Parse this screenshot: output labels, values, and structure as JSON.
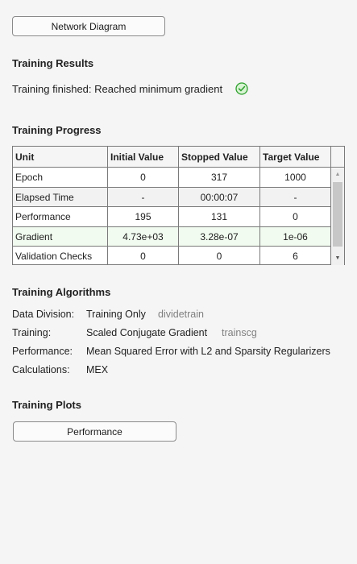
{
  "buttons": {
    "network_diagram": "Network Diagram",
    "performance": "Performance"
  },
  "results": {
    "title": "Training Results",
    "status": "Training finished: Reached minimum gradient",
    "status_icon": "check-circle-icon",
    "status_color": "#2ea02e"
  },
  "progress": {
    "title": "Training Progress",
    "columns": [
      "Unit",
      "Initial Value",
      "Stopped Value",
      "Target Value"
    ],
    "rows": [
      {
        "unit": "Epoch",
        "initial": "0",
        "stopped": "317",
        "target": "1000"
      },
      {
        "unit": "Elapsed Time",
        "initial": "-",
        "stopped": "00:00:07",
        "target": "-"
      },
      {
        "unit": "Performance",
        "initial": "195",
        "stopped": "131",
        "target": "0"
      },
      {
        "unit": "Gradient",
        "initial": "4.73e+03",
        "stopped": "3.28e-07",
        "target": "1e-06"
      },
      {
        "unit": "Validation Checks",
        "initial": "0",
        "stopped": "0",
        "target": "6"
      }
    ],
    "highlight_color": "#f1fbef"
  },
  "algorithms": {
    "title": "Training Algorithms",
    "items": [
      {
        "label": "Data Division:",
        "value": "Training Only",
        "fn": "dividetrain"
      },
      {
        "label": "Training:",
        "value": "Scaled Conjugate Gradient",
        "fn": "trainscg"
      },
      {
        "label": "Performance:",
        "value": "Mean Squared Error with L2 and Sparsity Regularizers",
        "fn": ""
      },
      {
        "label": "Calculations:",
        "value": "MEX",
        "fn": ""
      }
    ]
  },
  "plots": {
    "title": "Training Plots"
  }
}
